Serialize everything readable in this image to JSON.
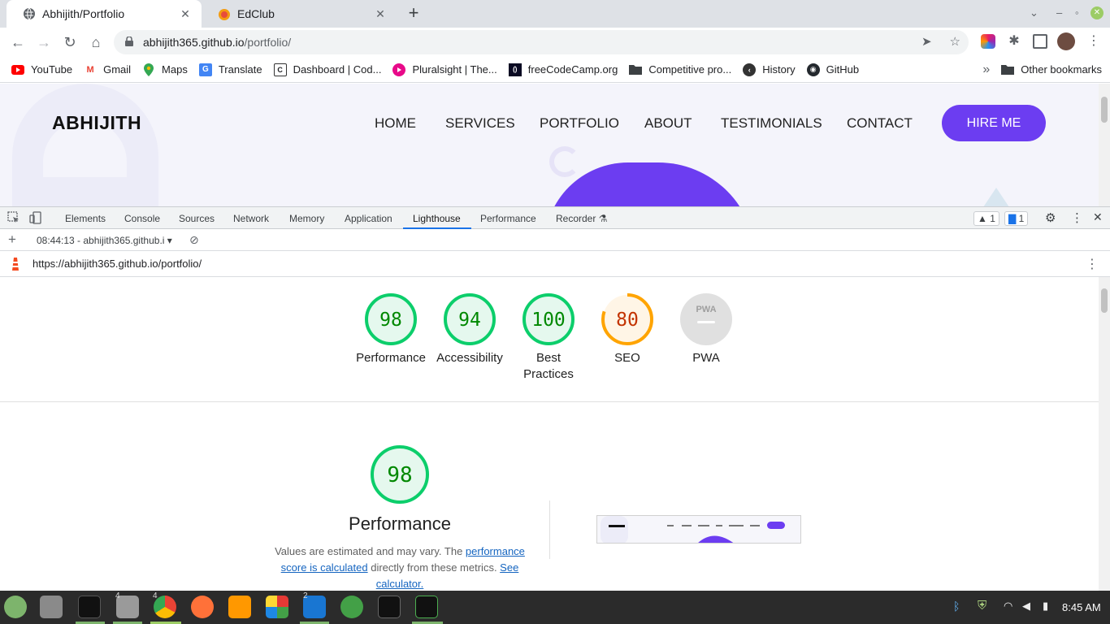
{
  "browser": {
    "tabs": [
      {
        "title": "Abhijith/Portfolio",
        "active": true
      },
      {
        "title": "EdClub",
        "active": false
      }
    ],
    "address": {
      "host": "abhijith365.github.io",
      "path": "/portfolio/"
    },
    "bookmarks": [
      {
        "label": "YouTube",
        "icon": "youtube-icon"
      },
      {
        "label": "Gmail",
        "icon": "gmail-icon"
      },
      {
        "label": "Maps",
        "icon": "maps-icon"
      },
      {
        "label": "Translate",
        "icon": "translate-icon"
      },
      {
        "label": "Dashboard | Cod...",
        "icon": "codechef-icon"
      },
      {
        "label": "Pluralsight | The...",
        "icon": "pluralsight-icon"
      },
      {
        "label": "freeCodeCamp.org",
        "icon": "freecodecamp-icon"
      },
      {
        "label": "Competitive pro...",
        "icon": "folder-icon"
      },
      {
        "label": "History",
        "icon": "history-icon"
      },
      {
        "label": "GitHub",
        "icon": "github-icon"
      }
    ],
    "other_bookmarks": "Other bookmarks",
    "more_bookmarks": "»"
  },
  "site": {
    "logo": "ABHIJITH",
    "nav": [
      "HOME",
      "SERVICES",
      "PORTFOLIO",
      "ABOUT",
      "TESTIMONIALS",
      "CONTACT"
    ],
    "cta": "HIRE ME",
    "accent": "#6c3df1"
  },
  "devtools": {
    "tabs": [
      "Elements",
      "Console",
      "Sources",
      "Network",
      "Memory",
      "Application",
      "Lighthouse",
      "Performance",
      "Recorder"
    ],
    "active_tab": "Lighthouse",
    "warnings": "1",
    "messages": "1",
    "report_selector": "08:44:13 - abhijith365.github.i",
    "report_url": "https://abhijith365.github.io/portfolio/"
  },
  "lighthouse": {
    "scores": [
      {
        "name": "Performance",
        "score": "98",
        "color": "#0cce6b",
        "text": "#008800",
        "bg": "#e5f8ee"
      },
      {
        "name": "Accessibility",
        "score": "94",
        "color": "#0cce6b",
        "text": "#008800",
        "bg": "#e5f8ee"
      },
      {
        "name": "Best Practices",
        "score": "100",
        "color": "#0cce6b",
        "text": "#008800",
        "bg": "#e5f8ee"
      },
      {
        "name": "SEO",
        "score": "80",
        "color": "#ffa400",
        "text": "#c33300",
        "bg": "#fff5e6"
      }
    ],
    "pwa": {
      "name": "PWA",
      "badge": "PWA"
    },
    "detail": {
      "score": "98",
      "title": "Performance",
      "desc_before": "Values are estimated and may vary. The ",
      "desc_link1": "performance score is calculated",
      "desc_middle": " directly from these metrics. ",
      "desc_link2": "See calculator."
    }
  },
  "taskbar": {
    "clock": "8:45 AM",
    "badges": {
      "files": "4",
      "chrome": "4",
      "vscode": "2"
    }
  }
}
